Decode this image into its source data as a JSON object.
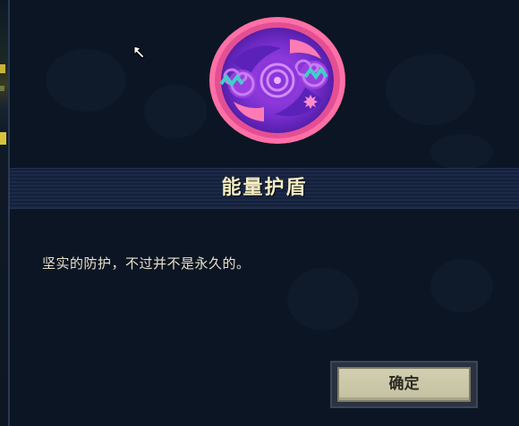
{
  "item": {
    "name": "能量护盾",
    "description": "坚实的防护，不过并不是永久的。",
    "icon": "energy-shield-icon"
  },
  "dialog": {
    "confirm_label": "确定"
  },
  "colors": {
    "background": "#0c1524",
    "title_text": "#f4ecc4",
    "button_face": "#c9c6a7",
    "icon_pink": "#ff6fa8",
    "icon_purple": "#7b34d6",
    "icon_teal": "#3fd0c8"
  }
}
